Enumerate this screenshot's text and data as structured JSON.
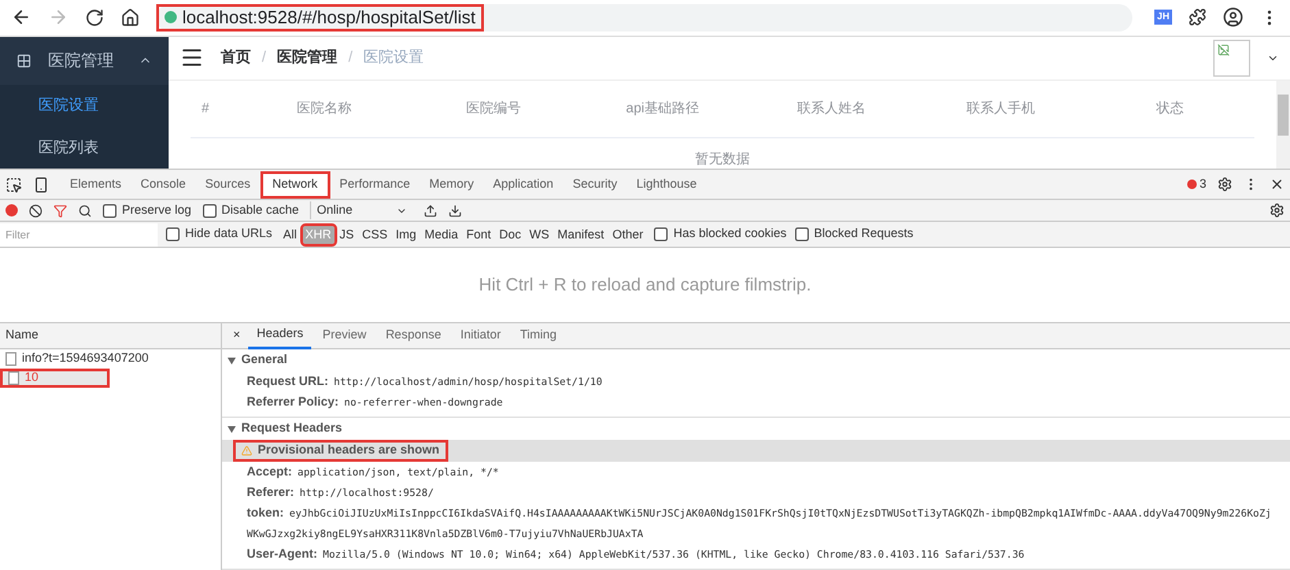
{
  "browser": {
    "url": "localhost:9528/#/hosp/hospitalSet/list",
    "url_highlighted": true,
    "extension_badge": "JH"
  },
  "sidebar": {
    "menu_title": "医院管理",
    "expanded": true,
    "items": [
      {
        "label": "医院设置",
        "selected": true
      },
      {
        "label": "医院列表",
        "selected": false
      }
    ]
  },
  "breadcrumb_separator": "/",
  "breadcrumb": [
    {
      "label": "首页",
      "current": false
    },
    {
      "label": "医院管理",
      "current": false
    },
    {
      "label": "医院设置",
      "current": true
    }
  ],
  "table": {
    "columns": [
      "#",
      "医院名称",
      "医院编号",
      "api基础路径",
      "联系人姓名",
      "联系人手机",
      "状态"
    ],
    "empty_text": "暂无数据"
  },
  "devtools": {
    "tabs": [
      {
        "label": "Elements",
        "selected": false,
        "highlighted": false
      },
      {
        "label": "Console",
        "selected": false,
        "highlighted": false
      },
      {
        "label": "Sources",
        "selected": false,
        "highlighted": false
      },
      {
        "label": "Network",
        "selected": true,
        "highlighted": true
      },
      {
        "label": "Performance",
        "selected": false,
        "highlighted": false
      },
      {
        "label": "Memory",
        "selected": false,
        "highlighted": false
      },
      {
        "label": "Application",
        "selected": false,
        "highlighted": false
      },
      {
        "label": "Security",
        "selected": false,
        "highlighted": false
      },
      {
        "label": "Lighthouse",
        "selected": false,
        "highlighted": false
      }
    ],
    "error_count": "3",
    "toolbar": {
      "recording": true,
      "preserve_log": {
        "label": "Preserve log",
        "checked": false
      },
      "disable_cache": {
        "label": "Disable cache",
        "checked": false
      },
      "throttling": "Online"
    },
    "filter": {
      "placeholder": "Filter",
      "hide_data_urls": {
        "label": "Hide data URLs",
        "checked": false
      },
      "types": [
        {
          "label": "All",
          "selected": false,
          "highlighted": false
        },
        {
          "label": "XHR",
          "selected": true,
          "highlighted": true
        },
        {
          "label": "JS",
          "selected": false,
          "highlighted": false
        },
        {
          "label": "CSS",
          "selected": false,
          "highlighted": false
        },
        {
          "label": "Img",
          "selected": false,
          "highlighted": false
        },
        {
          "label": "Media",
          "selected": false,
          "highlighted": false
        },
        {
          "label": "Font",
          "selected": false,
          "highlighted": false
        },
        {
          "label": "Doc",
          "selected": false,
          "highlighted": false
        },
        {
          "label": "WS",
          "selected": false,
          "highlighted": false
        },
        {
          "label": "Manifest",
          "selected": false,
          "highlighted": false
        },
        {
          "label": "Other",
          "selected": false,
          "highlighted": false
        }
      ],
      "has_blocked_cookies": {
        "label": "Has blocked cookies",
        "checked": false
      },
      "blocked_requests": {
        "label": "Blocked Requests",
        "checked": false
      }
    },
    "filmstrip_hint": "Hit Ctrl + R to reload and capture filmstrip.",
    "requests": {
      "header": "Name",
      "rows": [
        {
          "name": "info?t=1594693407200",
          "selected": false,
          "failed": false,
          "highlighted": false
        },
        {
          "name": "10",
          "selected": true,
          "failed": true,
          "highlighted": true
        }
      ]
    },
    "detail": {
      "close": "×",
      "tabs": [
        {
          "label": "Headers",
          "selected": true
        },
        {
          "label": "Preview",
          "selected": false
        },
        {
          "label": "Response",
          "selected": false
        },
        {
          "label": "Initiator",
          "selected": false
        },
        {
          "label": "Timing",
          "selected": false
        }
      ],
      "sections": [
        {
          "title": "General",
          "expanded": true,
          "rows": [
            {
              "key": "Request URL:",
              "value": "http://localhost/admin/hosp/hospitalSet/1/10"
            },
            {
              "key": "Referrer Policy:",
              "value": "no-referrer-when-downgrade"
            }
          ]
        },
        {
          "title": "Request Headers",
          "expanded": true,
          "warning": "Provisional headers are shown",
          "warning_highlighted": true,
          "rows": [
            {
              "key": "Accept:",
              "value": "application/json, text/plain, */*"
            },
            {
              "key": "Referer:",
              "value": "http://localhost:9528/"
            },
            {
              "key": "token:",
              "value": "eyJhbGciOiJIUzUxMiIsInppcCI6IkdaSVAifQ.H4sIAAAAAAAAAKtWKi5NUrJSCjAK0A0Ndg1S01FKrShQsjI0tTQxNjEzsDTWUSotTi3yTAGKQZh-ibmpQB2mpkq1AIWfmDc-AAAA.ddyVa47OQ9Ny9m226KoZj",
              "continuation": "WKwGJzxg2kiy8ngEL9YsaHXR311K8Vnla5DZBlV6m0-T7ujyiu7VhNaUERbJUAxTA"
            },
            {
              "key": "User-Agent:",
              "value": "Mozilla/5.0 (Windows NT 10.0; Win64; x64) AppleWebKit/537.36 (KHTML, like Gecko) Chrome/83.0.4103.116 Safari/537.36"
            }
          ]
        }
      ]
    }
  }
}
